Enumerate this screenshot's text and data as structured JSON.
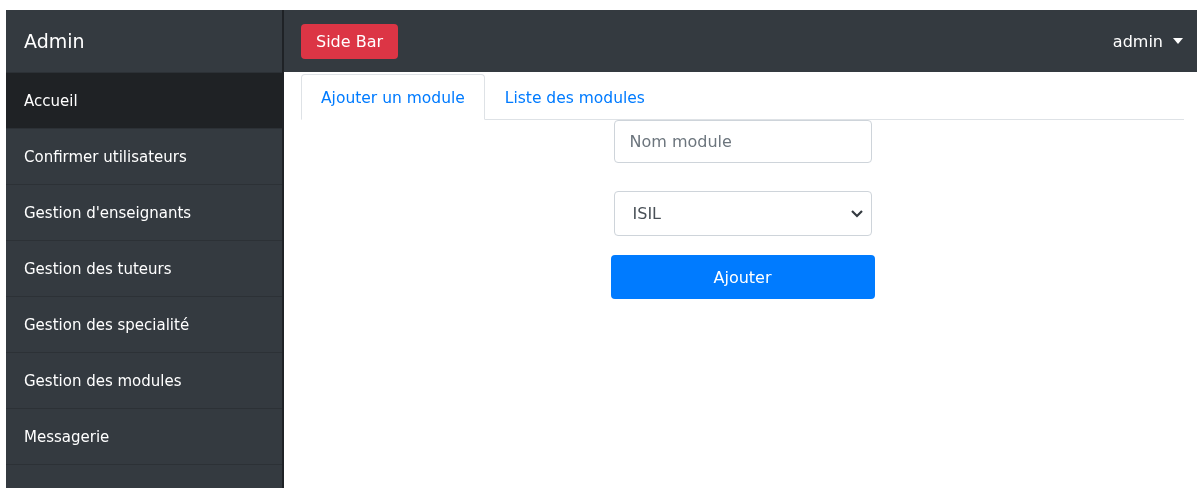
{
  "sidebar": {
    "title": "Admin",
    "items": [
      {
        "label": "Accueil",
        "selected": true
      },
      {
        "label": "Confirmer utilisateurs",
        "selected": false
      },
      {
        "label": "Gestion d'enseignants",
        "selected": false
      },
      {
        "label": "Gestion des tuteurs",
        "selected": false
      },
      {
        "label": "Gestion des specialité",
        "selected": false
      },
      {
        "label": "Gestion des modules",
        "selected": false
      },
      {
        "label": "Messagerie",
        "selected": false
      }
    ]
  },
  "navbar": {
    "toggle_button": "Side Bar",
    "user_menu": "admin"
  },
  "tabs": [
    {
      "label": "Ajouter un module",
      "selected": true
    },
    {
      "label": "Liste des modules",
      "selected": false
    }
  ],
  "form": {
    "name_field": {
      "placeholder": "Nom module"
    },
    "specialty_select": {
      "value": "ISIL"
    },
    "submit_button": "Ajouter"
  }
}
